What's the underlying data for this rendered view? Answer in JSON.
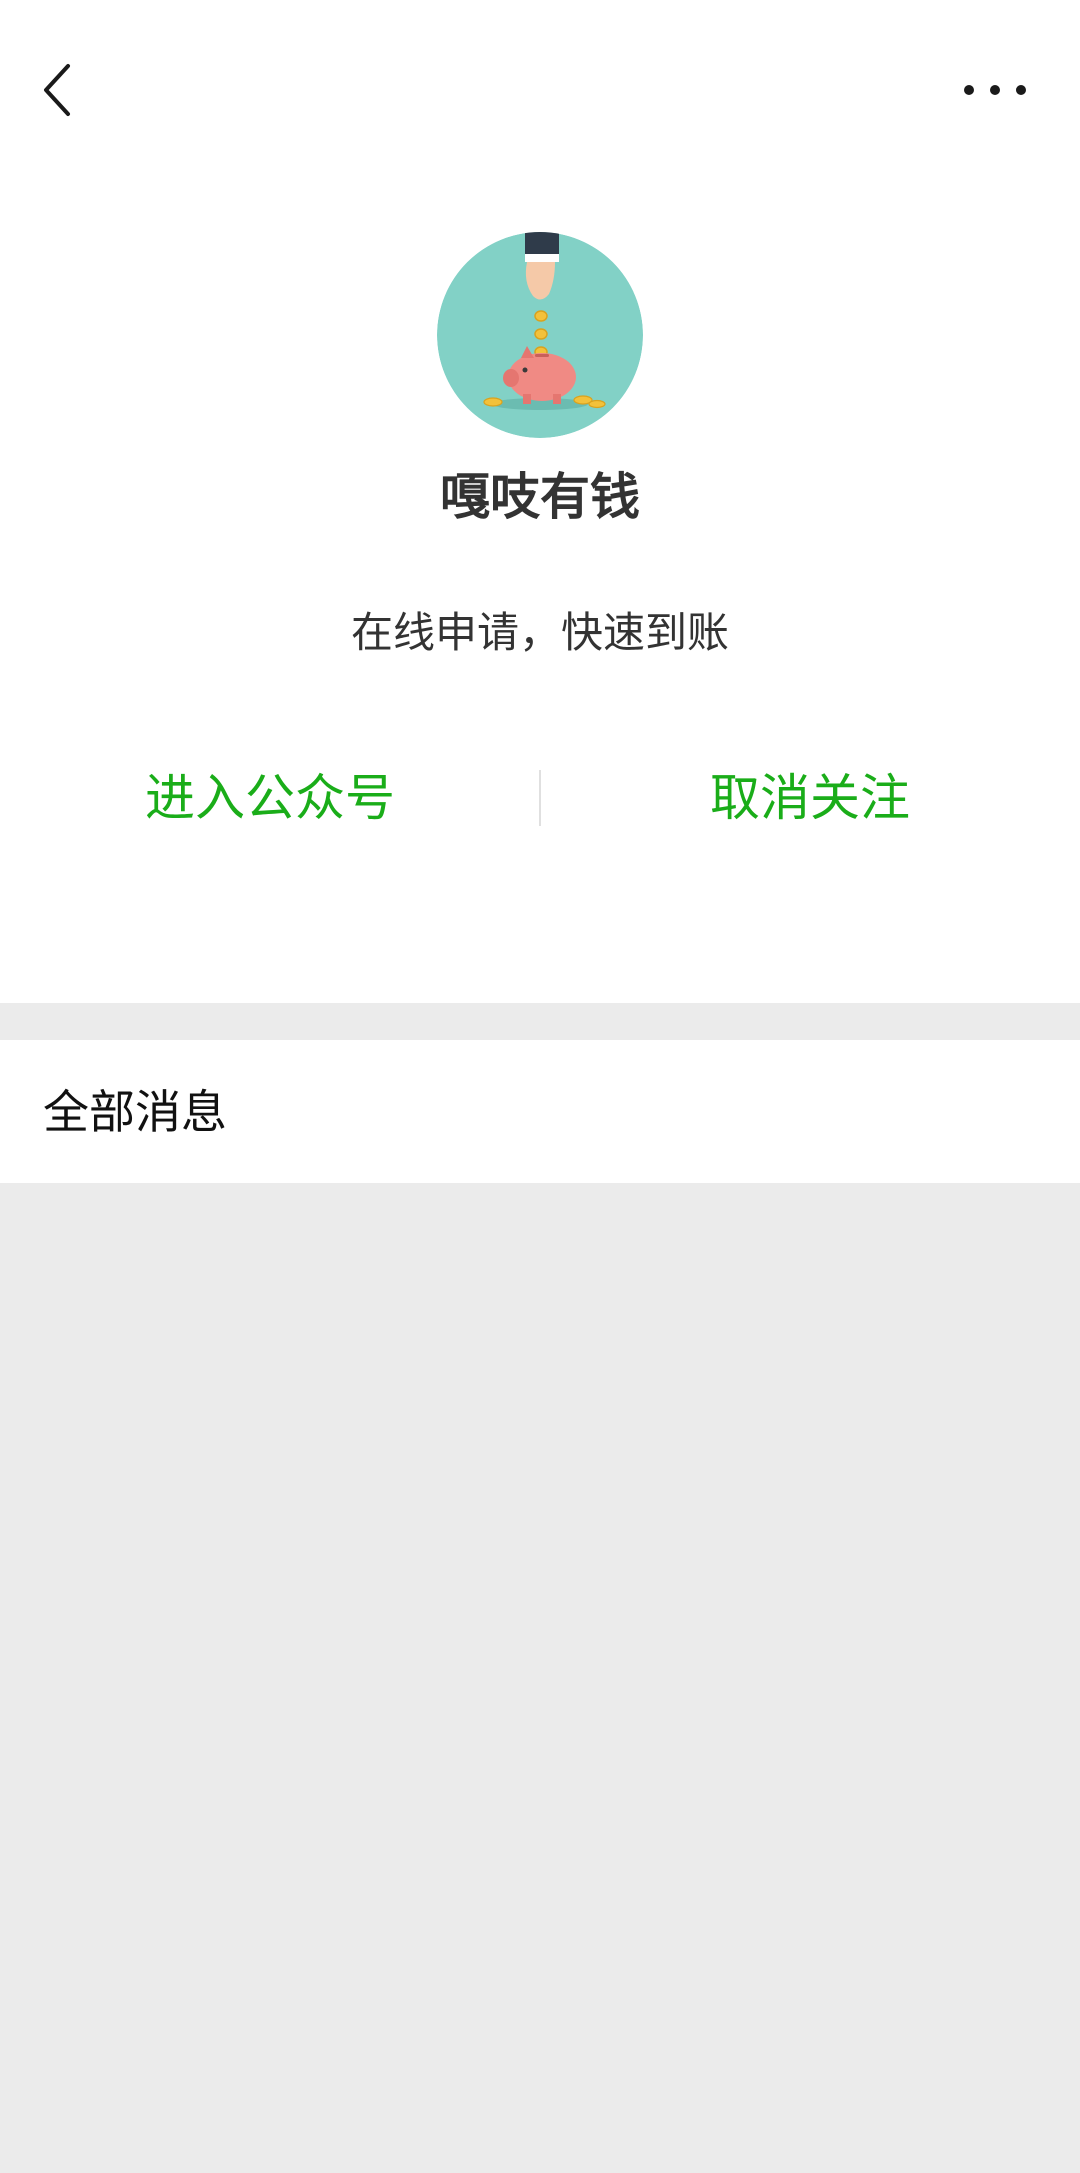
{
  "nav": {
    "back_icon": "chevron-left-icon",
    "more_icon": "more-dots-icon"
  },
  "profile": {
    "avatar_icon": "piggy-bank-avatar",
    "name": "嘎吱有钱",
    "description": "在线申请，快速到账"
  },
  "actions": {
    "enter_label": "进入公众号",
    "unfollow_label": "取消关注"
  },
  "messages": {
    "title": "全部消息"
  },
  "colors": {
    "accent_green": "#1aad19",
    "background_gray": "#ebebeb",
    "avatar_teal": "#82d1c6"
  }
}
